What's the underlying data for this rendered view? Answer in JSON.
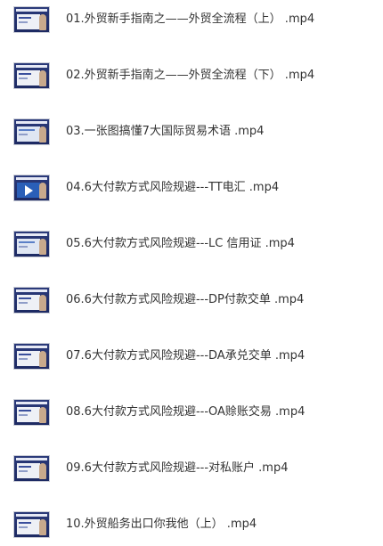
{
  "files": [
    {
      "name": "01.外贸新手指南之——外贸全流程（上） .mp4",
      "thumbnail_icon": "video-thumbnail-icon"
    },
    {
      "name": "02.外贸新手指南之——外贸全流程（下） .mp4",
      "thumbnail_icon": "video-thumbnail-icon"
    },
    {
      "name": "03.一张图搞懂7大国际贸易术语 .mp4",
      "thumbnail_icon": "video-thumbnail-icon"
    },
    {
      "name": "04.6大付款方式风险规避---TT电汇 .mp4",
      "thumbnail_icon": "video-thumbnail-icon"
    },
    {
      "name": "05.6大付款方式风险规避---LC 信用证 .mp4",
      "thumbnail_icon": "video-thumbnail-icon"
    },
    {
      "name": "06.6大付款方式风险规避---DP付款交单 .mp4",
      "thumbnail_icon": "video-thumbnail-icon"
    },
    {
      "name": "07.6大付款方式风险规避---DA承兑交单 .mp4",
      "thumbnail_icon": "video-thumbnail-icon"
    },
    {
      "name": "08.6大付款方式风险规避---OA赊账交易 .mp4",
      "thumbnail_icon": "video-thumbnail-icon"
    },
    {
      "name": "09.6大付款方式风险规避---对私账户 .mp4",
      "thumbnail_icon": "video-thumbnail-icon"
    },
    {
      "name": "10.外贸船务出口你我他（上） .mp4",
      "thumbnail_icon": "video-thumbnail-icon"
    }
  ]
}
